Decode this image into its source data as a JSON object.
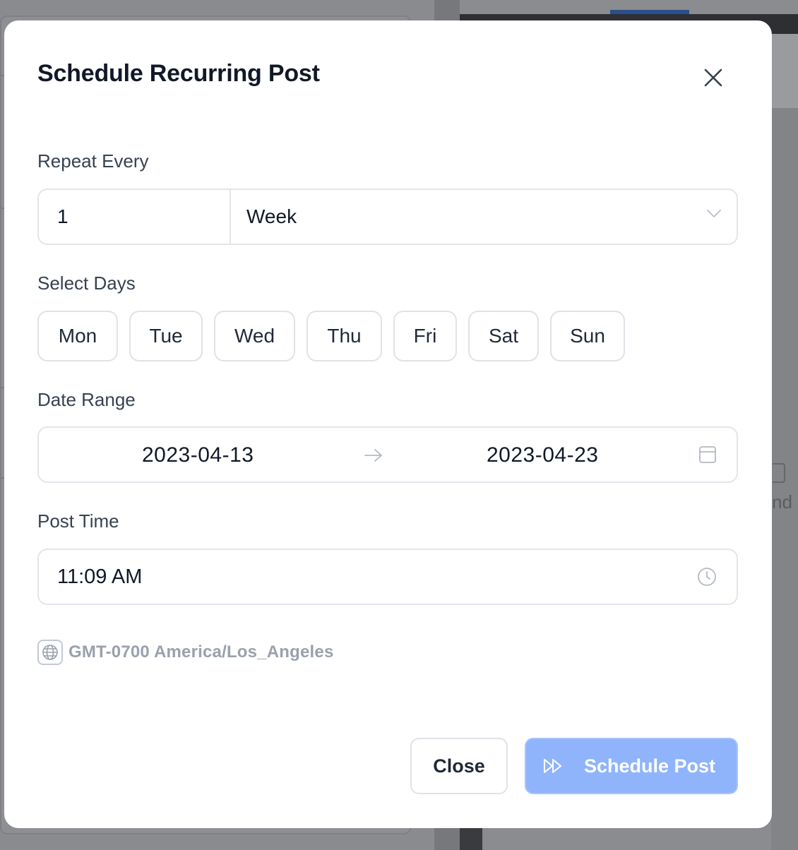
{
  "modal": {
    "title": "Schedule Recurring Post",
    "close_icon": "close-icon"
  },
  "repeat": {
    "label": "Repeat Every",
    "interval": "1",
    "unit": "Week",
    "unit_icon": "chevron-down-icon"
  },
  "days": {
    "label": "Select Days",
    "items": [
      "Mon",
      "Tue",
      "Wed",
      "Thu",
      "Fri",
      "Sat",
      "Sun"
    ]
  },
  "date_range": {
    "label": "Date Range",
    "start": "2023-04-13",
    "end": "2023-04-23",
    "arrow_icon": "arrow-right-icon",
    "calendar_icon": "calendar-icon"
  },
  "post_time": {
    "label": "Post Time",
    "value": "11:09 AM",
    "clock_icon": "clock-icon"
  },
  "timezone": {
    "text": "GMT-0700 America/Los_Angeles",
    "icon": "globe-icon"
  },
  "actions": {
    "close_label": "Close",
    "schedule_label": "Schedule Post",
    "schedule_icon": "fast-forward-icon"
  },
  "background": {
    "snippet": "nd"
  },
  "colors": {
    "primary_disabled": "#8fb4fb",
    "overlay": "#7c7d80",
    "text_primary": "#111827",
    "text_muted": "#9aa1ad"
  }
}
